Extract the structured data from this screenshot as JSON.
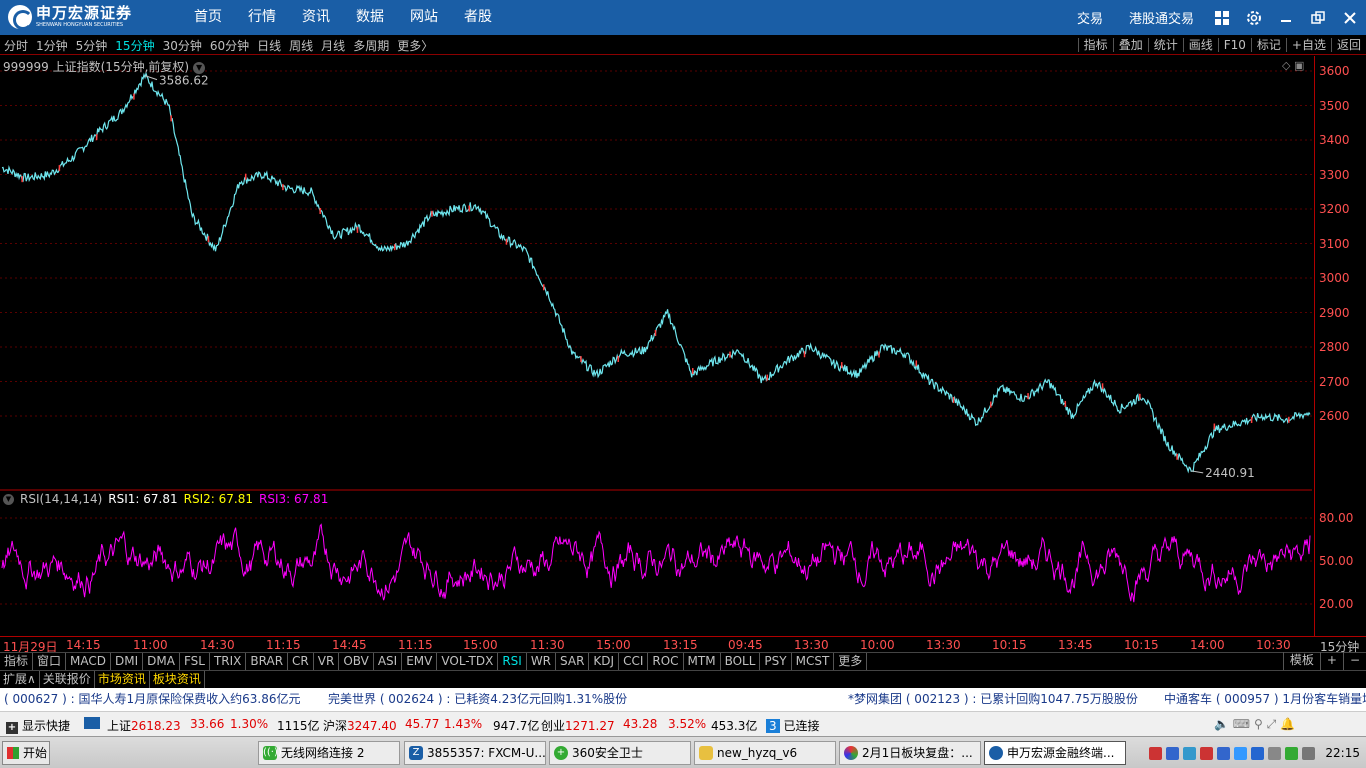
{
  "app": {
    "logo_cn": "申万宏源证券",
    "logo_en": "SHENWAN HONGYUAN SECURITIES",
    "nav": [
      "首页",
      "行情",
      "资讯",
      "数据",
      "网站",
      "者股"
    ],
    "right_links": [
      "交易",
      "港股通交易"
    ],
    "icons": [
      "grid-icon",
      "gear-icon",
      "minimize-icon",
      "restore-icon",
      "close-icon"
    ]
  },
  "periods": {
    "items": [
      "分时",
      "1分钟",
      "5分钟",
      "15分钟",
      "30分钟",
      "60分钟",
      "日线",
      "周线",
      "月线",
      "多周期",
      "更多〉"
    ],
    "active": "15分钟"
  },
  "toolbar_right": [
    "指标",
    "叠加",
    "统计",
    "画线",
    "F10",
    "标记",
    "+自选",
    "返回"
  ],
  "chart": {
    "title": "999999 上证指数(15分钟,前复权)",
    "high_label": "3586.62",
    "low_label": "2440.91"
  },
  "indicator": {
    "name": "RSI(14,14,14)",
    "rsi1": "RSI1: 67.81",
    "rsi2": "RSI2: 67.81",
    "rsi3": "RSI3: 67.81"
  },
  "price_axis": [
    "3600",
    "3500",
    "3400",
    "3300",
    "3200",
    "3100",
    "3000",
    "2900",
    "2800",
    "2700",
    "2600"
  ],
  "rsi_axis": [
    "80.00",
    "50.00",
    "20.00"
  ],
  "time_axis": [
    "11月29日",
    "14:15",
    "11:00",
    "14:30",
    "11:15",
    "14:45",
    "11:15",
    "15:00",
    "11:30",
    "15:00",
    "13:15",
    "09:45",
    "13:30",
    "10:00",
    "13:30",
    "10:15",
    "13:45",
    "10:15",
    "14:00",
    "10:30",
    "15分钟"
  ],
  "indicators": {
    "items": [
      "指标",
      "窗口",
      "MACD",
      "DMI",
      "DMA",
      "FSL",
      "TRIX",
      "BRAR",
      "CR",
      "VR",
      "OBV",
      "ASI",
      "EMV",
      "VOL-TDX",
      "RSI",
      "WR",
      "SAR",
      "KDJ",
      "CCI",
      "ROC",
      "MTM",
      "BOLL",
      "PSY",
      "MCST",
      "更多"
    ],
    "active": "RSI",
    "right": [
      "模板",
      "+",
      "−"
    ]
  },
  "tabs": {
    "items": [
      "扩展∧",
      "关联报价",
      "市场资讯",
      "板块资讯"
    ],
    "highlight": [
      "市场资讯",
      "板块资讯"
    ]
  },
  "news": [
    "( 000627 ) : 国华人寿1月原保险保费收入约63.86亿元",
    "完美世界 ( 002624 ) : 已耗资4.23亿元回购1.31%股份",
    "*梦网集团 ( 002123 ) : 已累计回购1047.75万股股份",
    "中通客车 ( 000957 ) 1月份客车销量增"
  ],
  "status": {
    "shortcut": "显示快捷",
    "sh_label": "上证",
    "sh_price": "2618.23",
    "sh_chg": "33.66",
    "sh_pct": "1.30%",
    "sh_amt": "1115亿",
    "sz_label": "沪深",
    "sz_price": "3247.40",
    "sz_chg": "45.77",
    "sz_pct": "1.43%",
    "sz_amt": "947.7亿",
    "cy_label": "创业",
    "cy_price": "1271.27",
    "cy_chg": "43.28",
    "cy_pct": "3.52%",
    "cy_amt": "453.3亿",
    "conn_num": "3",
    "conn": "已连接"
  },
  "taskbar": {
    "start": "开始",
    "items": [
      "无线网络连接 2",
      "3855357: FXCM-U...",
      "360安全卫士",
      "new_hyzq_v6",
      "2月1日板块复盘：...",
      "申万宏源金融终端..."
    ],
    "active": "申万宏源金融终端...",
    "clock": "22:15"
  },
  "chart_data": {
    "type": "line",
    "price_range": [
      2440.91,
      3586.62
    ],
    "price_ylim": [
      2400,
      3620
    ],
    "price_x_labels": [
      "11月29日",
      "14:15",
      "11:00",
      "14:30",
      "11:15",
      "14:45",
      "11:15",
      "15:00",
      "11:30",
      "15:00",
      "13:15",
      "09:45",
      "13:30",
      "10:00",
      "13:30",
      "10:15",
      "13:45",
      "10:15",
      "14:00",
      "10:30"
    ],
    "price_keypoints": [
      3320,
      3290,
      3300,
      3350,
      3420,
      3480,
      3586.62,
      3500,
      3180,
      3080,
      3280,
      3300,
      3260,
      3250,
      3120,
      3150,
      3080,
      3100,
      3180,
      3200,
      3210,
      3120,
      3080,
      2950,
      2780,
      2720,
      2780,
      2790,
      2900,
      2720,
      2760,
      2790,
      2700,
      2760,
      2800,
      2750,
      2720,
      2800,
      2780,
      2700,
      2650,
      2580,
      2680,
      2650,
      2700,
      2600,
      2700,
      2620,
      2660,
      2520,
      2440.91,
      2560,
      2580,
      2600,
      2590,
      2610
    ],
    "rsi_ylim": [
      0,
      100
    ],
    "series": [
      {
        "name": "RSI1",
        "value": 67.81,
        "color": "#ffffff"
      },
      {
        "name": "RSI2",
        "value": 67.81,
        "color": "#ffff00"
      },
      {
        "name": "RSI3",
        "value": 67.81,
        "color": "#ff00ff"
      }
    ]
  }
}
